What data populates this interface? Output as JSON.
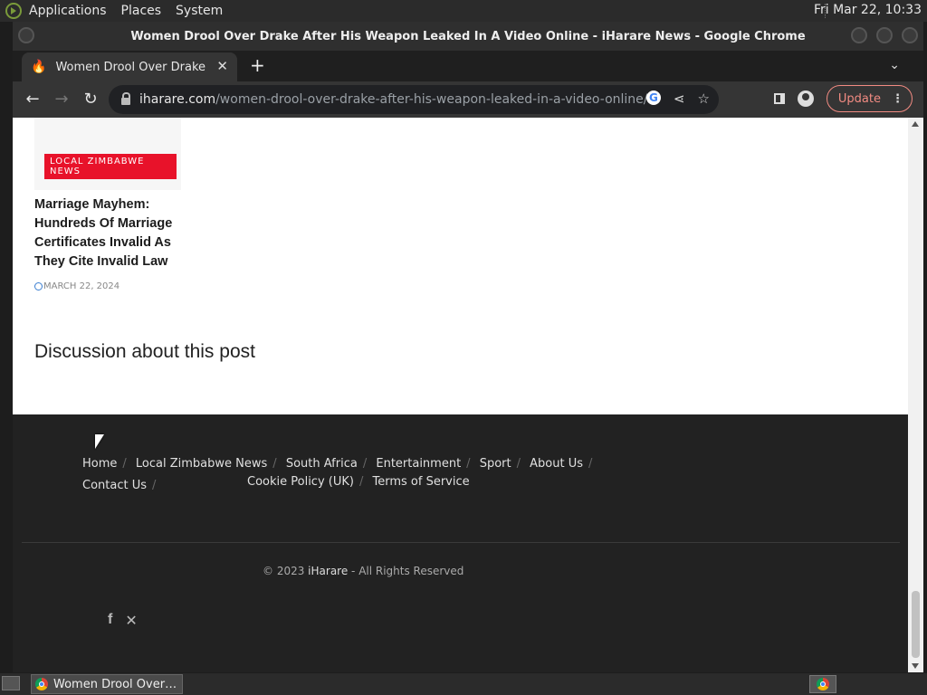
{
  "os_panel": {
    "menus": [
      "Applications",
      "Places",
      "System"
    ],
    "clock": "Fri Mar 22, 10:33"
  },
  "window": {
    "title": "Women Drool Over Drake After His Weapon Leaked In A Video Online - iHarare News - Google Chrome"
  },
  "tab": {
    "title": "Women Drool Over Drake After His Weapon Leaked In A Video Online",
    "close_glyph": "✕",
    "new_tab_glyph": "+",
    "menu_glyph": "⌄"
  },
  "toolbar": {
    "url_host": "iharare.com",
    "url_path": "/women-drool-over-drake-after-his-weapon-leaked-in-a-video-online/",
    "update_label": "Update"
  },
  "article_card": {
    "category": "LOCAL ZIMBABWE NEWS",
    "title": "Marriage Mayhem: Hundreds Of Marriage Certificates Invalid As They Cite Invalid Law",
    "date": "MARCH 22, 2024"
  },
  "discussion": {
    "heading": "Discussion about this post"
  },
  "footer": {
    "nav_row1": [
      "Home",
      "Local Zimbabwe News",
      "South Africa",
      "Entertainment",
      "Sport",
      "About Us",
      "Contact Us"
    ],
    "nav_row2": [
      "Cookie Policy (UK)",
      "Terms of Service"
    ],
    "copyright_prefix": "© 2023 ",
    "copyright_brand": "iHarare",
    "copyright_suffix": " - All Rights Reserved",
    "social_icons": [
      "facebook-icon",
      "x-icon"
    ]
  },
  "taskbar": {
    "task_label": "Women Drool Over Drake After His Weapon Leaked In A Video Online - iHarare News - Google Chrome"
  },
  "colors": {
    "badge_red": "#e8122a",
    "update_accent": "#f28b82",
    "footer_bg": "#222222"
  }
}
